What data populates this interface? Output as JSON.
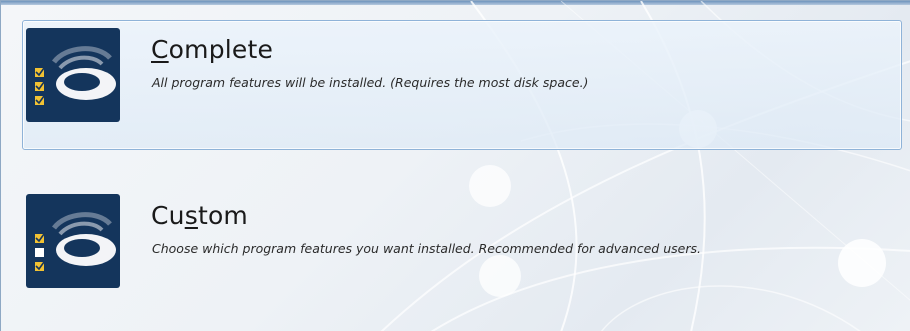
{
  "setup_types": [
    {
      "title_parts": [
        "",
        "C",
        "omplete"
      ],
      "description": "All program features will be installed. (Requires the most disk space.)",
      "icon": "disk-checklist-icon",
      "selected": true
    },
    {
      "title_parts": [
        "Cu",
        "s",
        "tom"
      ],
      "description": "Choose which program features you want installed. Recommended for advanced users.",
      "icon": "disk-checklist-icon",
      "selected": false
    }
  ],
  "colors": {
    "icon_background": "#14355c",
    "selection_border": "#8fb3d8",
    "checkmark": "#f2c233"
  }
}
